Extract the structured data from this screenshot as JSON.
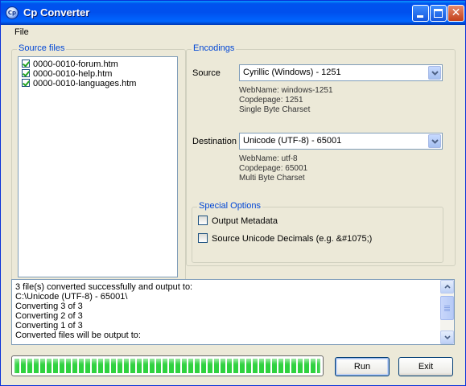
{
  "window": {
    "title": "Cp Converter",
    "app_icon_text": "Cp"
  },
  "menu": {
    "items": [
      {
        "label": "File"
      }
    ]
  },
  "source_files": {
    "title": "Source files",
    "files": [
      {
        "name": "0000-0010-forum.htm",
        "checked": true
      },
      {
        "name": "0000-0010-help.htm",
        "checked": true
      },
      {
        "name": "0000-0010-languages.htm",
        "checked": true
      }
    ]
  },
  "encodings": {
    "title": "Encodings",
    "source": {
      "label": "Source",
      "selected": "Cyrillic (Windows) - 1251",
      "info": [
        "WebName: windows-1251",
        "Copdepage: 1251",
        "Single Byte Charset"
      ]
    },
    "destination": {
      "label": "Destination",
      "selected": "Unicode (UTF-8) - 65001",
      "info": [
        "WebName: utf-8",
        "Copdepage: 65001",
        "Multi Byte Charset"
      ]
    },
    "special_options": {
      "title": "Special Options",
      "options": [
        {
          "label": "Output Metadata",
          "checked": false
        },
        {
          "label": "Source Unicode Decimals (e.g. &#1075;)",
          "checked": false
        }
      ]
    }
  },
  "log": {
    "lines": [
      "3 file(s) converted successfully and output to:",
      "C:\\Unicode (UTF-8) - 65001\\",
      "Converting 3 of 3",
      "Converting 2 of 3",
      "Converting 1 of 3",
      "Converted files will be output to:"
    ]
  },
  "progress": {
    "percent": 100
  },
  "buttons": {
    "run": "Run",
    "exit": "Exit"
  },
  "colors": {
    "group_title": "#0046d5",
    "progress_fill": "#2fd23f",
    "titlebar": "#0053ee"
  }
}
